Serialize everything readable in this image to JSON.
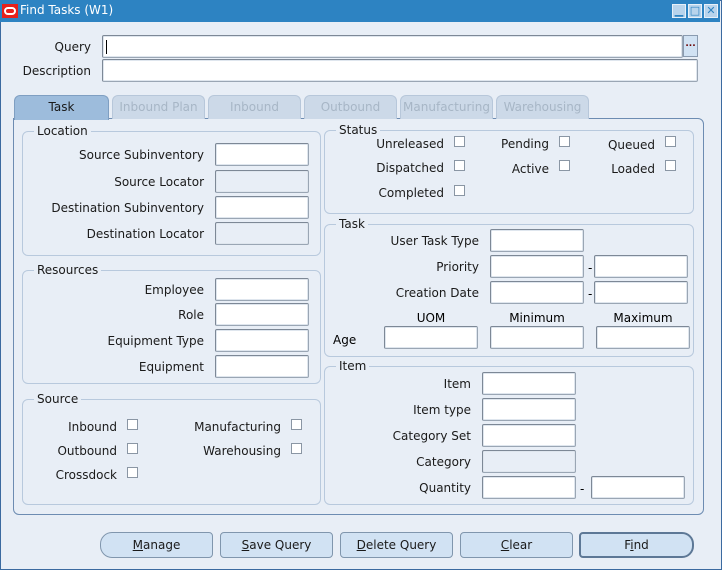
{
  "window": {
    "title": "Find Tasks (W1)",
    "controls": {
      "minimize": "▁",
      "maximize": "□",
      "close": "✕"
    }
  },
  "header": {
    "query_label": "Query",
    "query_value": "",
    "lov_label": "...",
    "description_label": "Description",
    "description_value": ""
  },
  "tabs": [
    {
      "label": "Task",
      "active": true
    },
    {
      "label": "Inbound Plan",
      "active": false
    },
    {
      "label": "Inbound",
      "active": false
    },
    {
      "label": "Outbound",
      "active": false
    },
    {
      "label": "Manufacturing",
      "active": false
    },
    {
      "label": "Warehousing",
      "active": false
    }
  ],
  "location": {
    "title": "Location",
    "source_subinventory": "Source Subinventory",
    "source_locator": "Source Locator",
    "destination_subinventory": "Destination Subinventory",
    "destination_locator": "Destination Locator"
  },
  "resources": {
    "title": "Resources",
    "employee": "Employee",
    "role": "Role",
    "equipment_type": "Equipment Type",
    "equipment": "Equipment"
  },
  "source": {
    "title": "Source",
    "inbound": "Inbound",
    "outbound": "Outbound",
    "crossdock": "Crossdock",
    "manufacturing": "Manufacturing",
    "warehousing": "Warehousing"
  },
  "status": {
    "title": "Status",
    "unreleased": "Unreleased",
    "pending": "Pending",
    "queued": "Queued",
    "dispatched": "Dispatched",
    "active": "Active",
    "loaded": "Loaded",
    "completed": "Completed"
  },
  "task": {
    "title": "Task",
    "user_task_type": "User Task Type",
    "priority": "Priority",
    "creation_date": "Creation Date",
    "range_separator": "-",
    "uom": "UOM",
    "minimum": "Minimum",
    "maximum": "Maximum",
    "age": "Age"
  },
  "item": {
    "title": "Item",
    "item": "Item",
    "item_type": "Item type",
    "category_set": "Category Set",
    "category": "Category",
    "quantity": "Quantity",
    "range_separator": "-"
  },
  "buttons": {
    "manage": {
      "mnemonic": "M",
      "rest": "anage"
    },
    "save_query": {
      "mnemonic": "S",
      "rest": "ave Query"
    },
    "delete_query": {
      "mnemonic": "D",
      "rest": "elete Query"
    },
    "clear": {
      "mnemonic": "C",
      "rest": "lear"
    },
    "find": {
      "pre": "F",
      "mnemonic": "i",
      "rest": "nd"
    }
  }
}
